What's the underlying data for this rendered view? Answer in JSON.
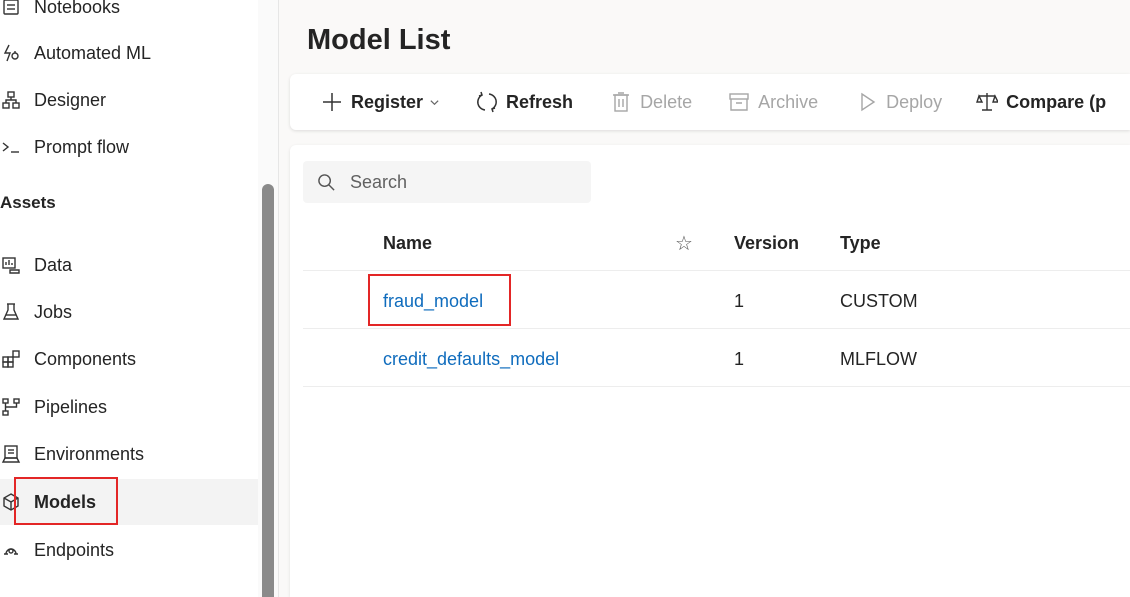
{
  "sidebar": {
    "items": [
      {
        "label": "Notebooks",
        "icon": "notebook-icon"
      },
      {
        "label": "Automated ML",
        "icon": "automated-ml-icon"
      },
      {
        "label": "Designer",
        "icon": "designer-icon"
      },
      {
        "label": "Prompt flow",
        "icon": "prompt-flow-icon"
      }
    ],
    "section_label": "Assets",
    "asset_items": [
      {
        "label": "Data",
        "icon": "data-icon"
      },
      {
        "label": "Jobs",
        "icon": "jobs-icon"
      },
      {
        "label": "Components",
        "icon": "components-icon"
      },
      {
        "label": "Pipelines",
        "icon": "pipelines-icon"
      },
      {
        "label": "Environments",
        "icon": "environments-icon"
      },
      {
        "label": "Models",
        "icon": "models-icon",
        "active": true
      },
      {
        "label": "Endpoints",
        "icon": "endpoints-icon"
      }
    ]
  },
  "main": {
    "title": "Model List",
    "toolbar": {
      "register": "Register",
      "refresh": "Refresh",
      "delete": "Delete",
      "archive": "Archive",
      "deploy": "Deploy",
      "compare": "Compare (p"
    },
    "search": {
      "placeholder": "Search"
    },
    "table": {
      "columns": {
        "name": "Name",
        "version": "Version",
        "type": "Type"
      },
      "rows": [
        {
          "name": "fraud_model",
          "version": "1",
          "type": "CUSTOM"
        },
        {
          "name": "credit_defaults_model",
          "version": "1",
          "type": "MLFLOW"
        }
      ]
    }
  },
  "colors": {
    "link": "#0f6cbd",
    "highlight": "#e32626",
    "active_bg": "#f3f3f3"
  }
}
